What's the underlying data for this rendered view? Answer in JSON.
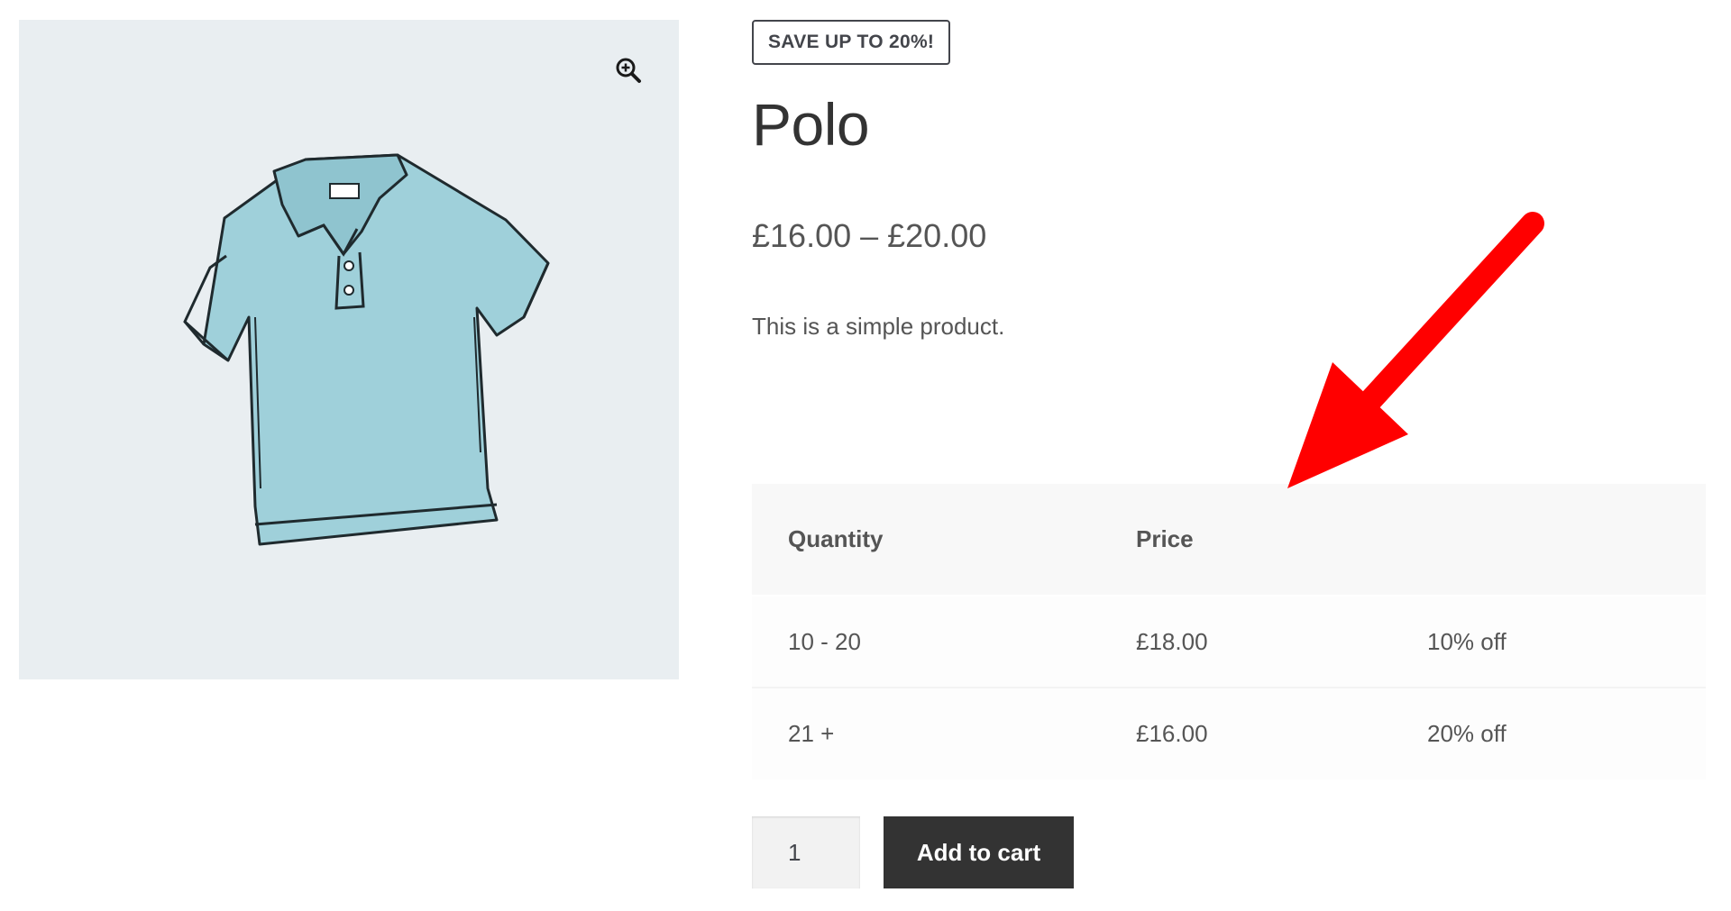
{
  "product": {
    "badge": "SAVE UP TO 20%!",
    "title": "Polo",
    "price_range": "£16.00 – £20.00",
    "description": "This is a simple product.",
    "image_icon": "polo-shirt-image",
    "zoom_icon": "zoom-in-icon"
  },
  "pricing_table": {
    "headers": [
      "Quantity",
      "Price",
      ""
    ],
    "rows": [
      [
        "10 - 20",
        "£18.00",
        "10% off"
      ],
      [
        "21 +",
        "£16.00",
        "20% off"
      ]
    ]
  },
  "cart": {
    "quantity": "1",
    "button_label": "Add to cart"
  },
  "colors": {
    "annotation_arrow": "#ff0000",
    "button_bg": "#333333",
    "image_bg": "#e9eef1",
    "shirt": "#9bcfd9"
  }
}
